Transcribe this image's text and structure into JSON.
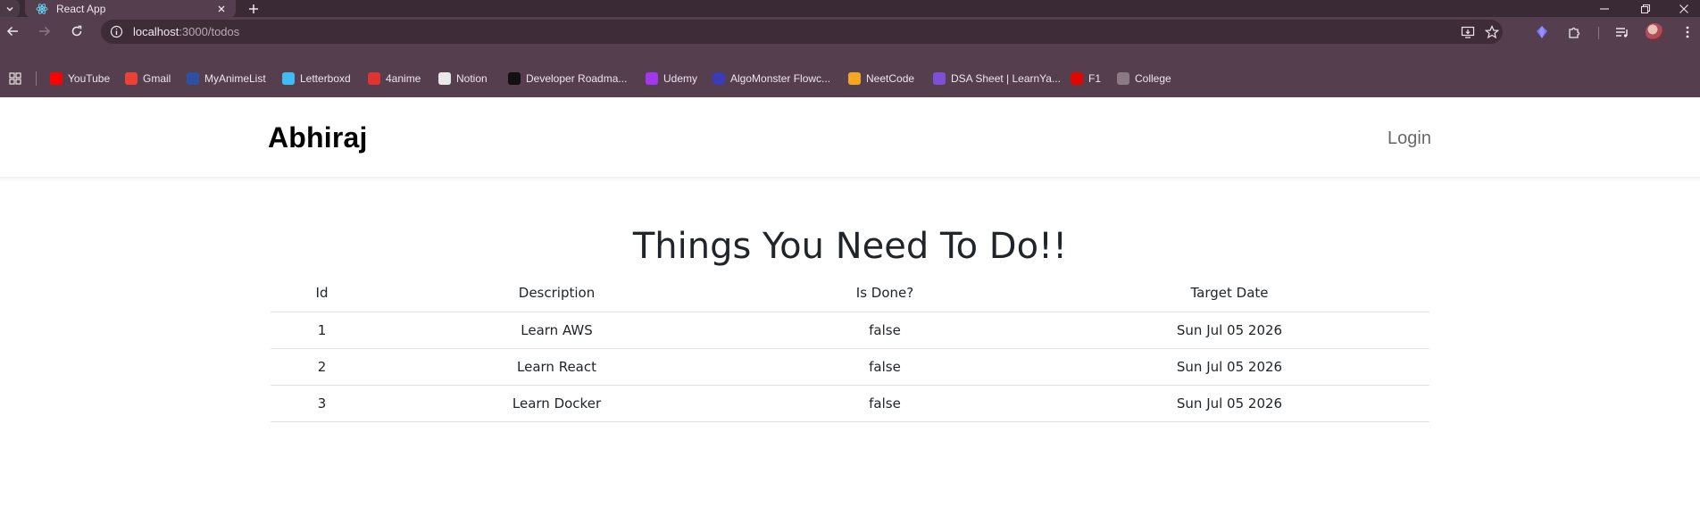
{
  "browser": {
    "tab": {
      "title": "React App"
    },
    "url": {
      "host": "localhost",
      "path": ":3000/todos"
    },
    "bookmarks": [
      {
        "label": "YouTube",
        "icon": "youtube-icon",
        "color": "#ff0000"
      },
      {
        "label": "Gmail",
        "icon": "gmail-icon",
        "color": "#ea4335"
      },
      {
        "label": "MyAnimeList",
        "icon": "myanimelist-icon",
        "color": "#2e51a2"
      },
      {
        "label": "Letterboxd",
        "icon": "letterboxd-icon",
        "color": "#40bcf4"
      },
      {
        "label": "4anime",
        "icon": "4anime-icon",
        "color": "#e0342f"
      },
      {
        "label": "Notion",
        "icon": "notion-icon",
        "color": "#e8e8e8"
      },
      {
        "label": "Developer Roadma...",
        "icon": "roadmap-icon",
        "color": "#111111"
      },
      {
        "label": "Udemy",
        "icon": "udemy-icon",
        "color": "#a435f0"
      },
      {
        "label": "AlgoMonster Flowc...",
        "icon": "algomonster-icon",
        "color": "#3b3bb3"
      },
      {
        "label": "NeetCode",
        "icon": "neetcode-icon",
        "color": "#f5a623"
      },
      {
        "label": "DSA Sheet | LearnYa...",
        "icon": "learnyard-icon",
        "color": "#7b4fd6"
      },
      {
        "label": "F1",
        "icon": "f1-icon",
        "color": "#e10600"
      },
      {
        "label": "College",
        "icon": "college-icon",
        "color": "#8c7986"
      }
    ]
  },
  "navbar": {
    "brand": "Abhiraj",
    "login": "Login"
  },
  "main": {
    "heading": "Things You Need To Do!!",
    "columns": [
      "Id",
      "Description",
      "Is Done?",
      "Target Date"
    ],
    "rows": [
      [
        "1",
        "Learn AWS",
        "false",
        "Sun Jul 05 2026"
      ],
      [
        "2",
        "Learn React",
        "false",
        "Sun Jul 05 2026"
      ],
      [
        "3",
        "Learn Docker",
        "false",
        "Sun Jul 05 2026"
      ]
    ]
  },
  "colors": {
    "chrome": "#553e4e",
    "tabstrip": "#3a2a35",
    "text": "#212529",
    "divider": "#dee2e6"
  }
}
